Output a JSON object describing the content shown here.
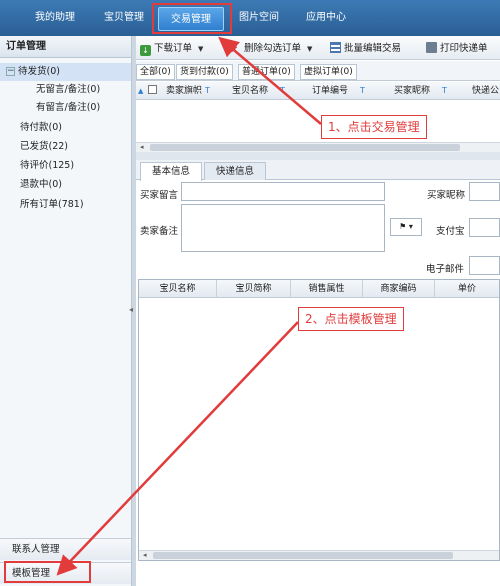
{
  "nav": {
    "items": [
      "我的助理",
      "宝贝管理",
      "交易管理",
      "图片空间",
      "应用中心"
    ],
    "active_index": 2
  },
  "sidebar": {
    "title": "订单管理",
    "tree": [
      {
        "label": "待发货(0)",
        "expander": "−"
      },
      {
        "label": "无留言/备注(0)"
      },
      {
        "label": "有留言/备注(0)"
      },
      {
        "label": "待付款(0)"
      },
      {
        "label": "已发货(22)"
      },
      {
        "label": "待评价(125)"
      },
      {
        "label": "退款中(0)"
      },
      {
        "label": "所有订单(781)"
      }
    ],
    "contacts": "联系人管理",
    "templates": "模板管理"
  },
  "toolbar": {
    "download": "下载订单",
    "delete_checked": "删除勾选订单",
    "batch_edit": "批量编辑交易",
    "print_express": "打印快递单"
  },
  "subtabs": [
    "全部(0)",
    "货到付款(0)",
    "普通订单(0)",
    "虚拟订单(0)"
  ],
  "order_grid": {
    "columns": [
      "卖家旗帜",
      "宝贝名称",
      "订单编号",
      "买家昵称",
      "快递公"
    ]
  },
  "detail_tabs": [
    "基本信息",
    "快递信息"
  ],
  "form": {
    "buyer_message": "买家留言",
    "buyer_nick": "买家昵称",
    "seller_note": "卖家备注",
    "alipay": "支付宝",
    "email": "电子邮件",
    "flag": "⚑ ▾"
  },
  "item_table": {
    "columns": [
      "宝贝名称",
      "宝贝简称",
      "销售属性",
      "商家编码",
      "单价"
    ]
  },
  "annotations": {
    "step1": "1、点击交易管理",
    "step2": "2、点击模板管理"
  },
  "colors": {
    "nav_bg": "#2a5f95",
    "annotation": "#e23b3b"
  }
}
